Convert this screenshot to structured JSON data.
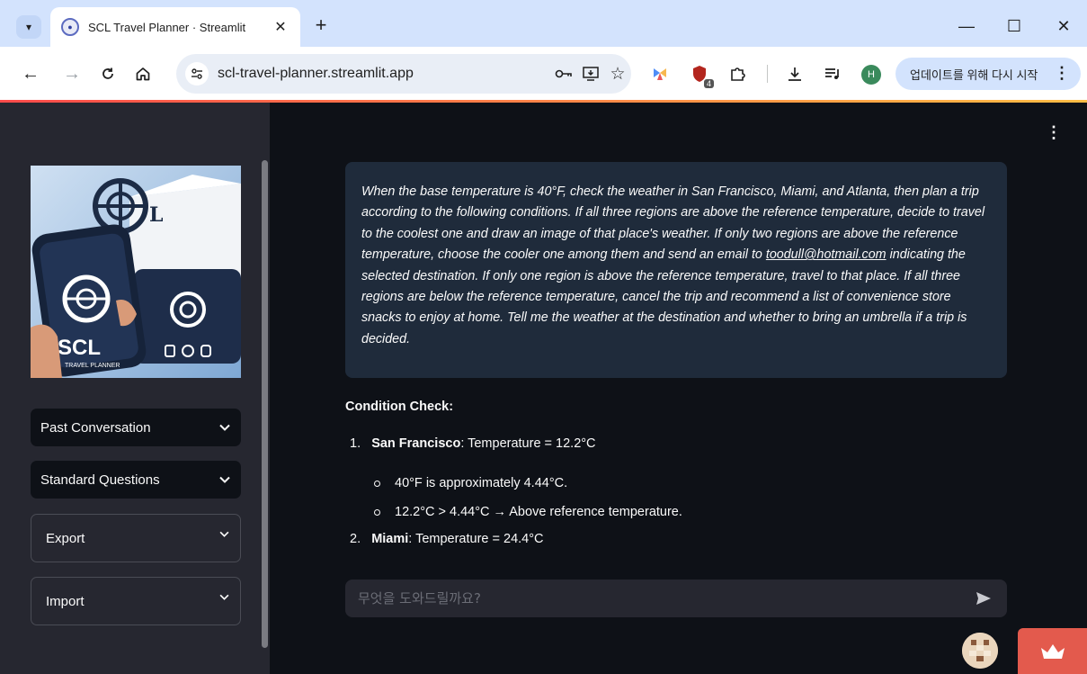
{
  "browser": {
    "tab": {
      "title": "SCL Travel Planner · Streamlit",
      "close": "✕"
    },
    "new_tab": "+",
    "window": {
      "minimize": "—",
      "maximize": "☐",
      "close": "✕"
    },
    "url": "scl-travel-planner.streamlit.app",
    "extension_badge": "4",
    "profile_initial": "H",
    "update_button": "업데이트를 위해 다시 시작"
  },
  "sidebar": {
    "expanders": [
      {
        "label": "Past Conversation"
      },
      {
        "label": "Standard Questions"
      },
      {
        "label": "Export"
      },
      {
        "label": "Import"
      }
    ]
  },
  "chat": {
    "user_message": {
      "before_email": "When the base temperature is 40°F, check the weather in San Francisco, Miami, and Atlanta, then plan a trip according to the following conditions. If all three regions are above the reference temperature, decide to travel to the coolest one and draw an image of that place's weather. If only two regions are above the reference temperature, choose the cooler one among them and send an email to",
      "email": "toodull@hotmail.com",
      "after_email": "indicating the selected destination. If only one region is above the reference temperature, travel to that place. If all three regions are below the reference temperature, cancel the trip and recommend a list of convenience store snacks to enjoy at home. Tell me the weather at the destination and whether to bring an umbrella if a trip is decided."
    },
    "answer": {
      "heading": "Condition Check:",
      "items": [
        {
          "number": "1.",
          "city": "San Francisco",
          "detail": ": Temperature = 12.2°C",
          "bullets": [
            "40°F is approximately 4.44°C.",
            "12.2°C > 4.44°C → Above reference temperature."
          ]
        },
        {
          "number": "2.",
          "city": "Miami",
          "detail": ": Temperature = 24.4°C"
        }
      ]
    },
    "input_placeholder": "무엇을 도와드릴까요?"
  },
  "logo_text": {
    "brand": "SCL",
    "tagline": "TRAVEL PLANNER"
  },
  "colors": {
    "accent": "#ff4b4b",
    "sidebar": "#262730",
    "main": "#0e1117",
    "user_bubble": "#1f2b3b",
    "badge": "#e35a4d"
  }
}
